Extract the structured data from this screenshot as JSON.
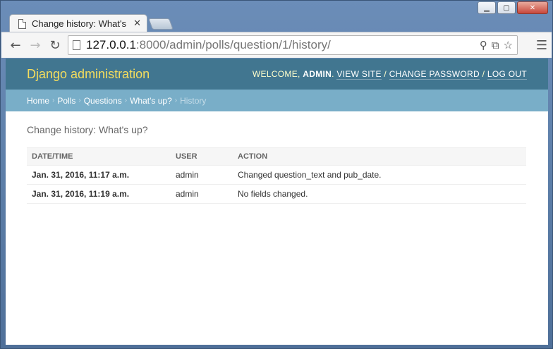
{
  "browser": {
    "tab_title": "Change history: What's up?",
    "url_host": "127.0.0.1",
    "url_rest": ":8000/admin/polls/question/1/history/"
  },
  "header": {
    "branding": "Django administration",
    "welcome": "WELCOME,",
    "username": "ADMIN",
    "view_site": "VIEW SITE",
    "change_password": "CHANGE PASSWORD",
    "log_out": "LOG OUT"
  },
  "breadcrumbs": {
    "home": "Home",
    "polls": "Polls",
    "questions": "Questions",
    "object": "What's up?",
    "current": "History"
  },
  "main": {
    "title": "Change history: What's up?",
    "columns": [
      "DATE/TIME",
      "USER",
      "ACTION"
    ],
    "rows": [
      {
        "datetime": "Jan. 31, 2016, 11:17 a.m.",
        "user": "admin",
        "action": "Changed question_text and pub_date."
      },
      {
        "datetime": "Jan. 31, 2016, 11:19 a.m.",
        "user": "admin",
        "action": "No fields changed."
      }
    ]
  }
}
